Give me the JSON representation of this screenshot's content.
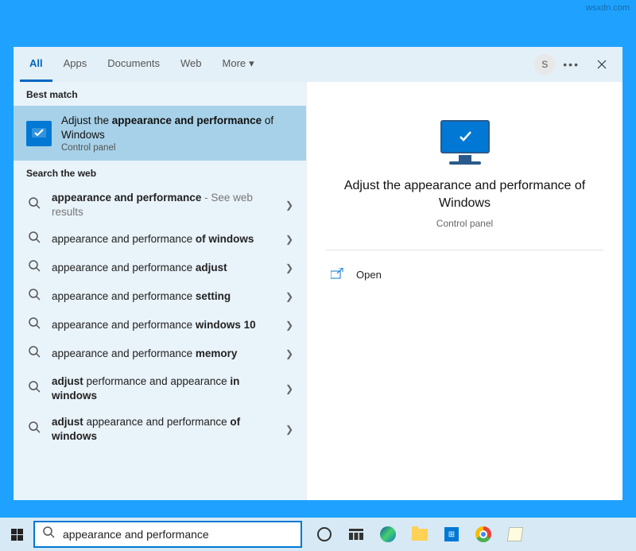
{
  "watermark": "wsxdn.com",
  "header": {
    "tabs": [
      {
        "label": "All",
        "active": true
      },
      {
        "label": "Apps",
        "active": false
      },
      {
        "label": "Documents",
        "active": false
      },
      {
        "label": "Web",
        "active": false
      },
      {
        "label": "More",
        "active": false,
        "dropdown": true
      }
    ],
    "avatar_initial": "S"
  },
  "left": {
    "best_match_header": "Best match",
    "best_match": {
      "title_html": "Adjust the <b>appearance and performance</b> of Windows",
      "subtitle": "Control panel"
    },
    "web_header": "Search the web",
    "web_results": [
      {
        "html": "<b>appearance and performance</b> <span class='extra'>- See web results</span>"
      },
      {
        "html": "appearance and performance <b>of windows</b>"
      },
      {
        "html": "appearance and performance <b>adjust</b>"
      },
      {
        "html": "appearance and performance <b>setting</b>"
      },
      {
        "html": "appearance and performance <b>windows 10</b>"
      },
      {
        "html": "appearance and performance <b>memory</b>"
      },
      {
        "html": "<b>adjust</b> performance and appearance <b>in windows</b>"
      },
      {
        "html": "<b>adjust</b> appearance and performance <b>of windows</b>"
      }
    ]
  },
  "right": {
    "title": "Adjust the appearance and performance of Windows",
    "subtitle": "Control panel",
    "actions": {
      "open": "Open"
    }
  },
  "taskbar": {
    "search_value": "appearance and performance"
  }
}
